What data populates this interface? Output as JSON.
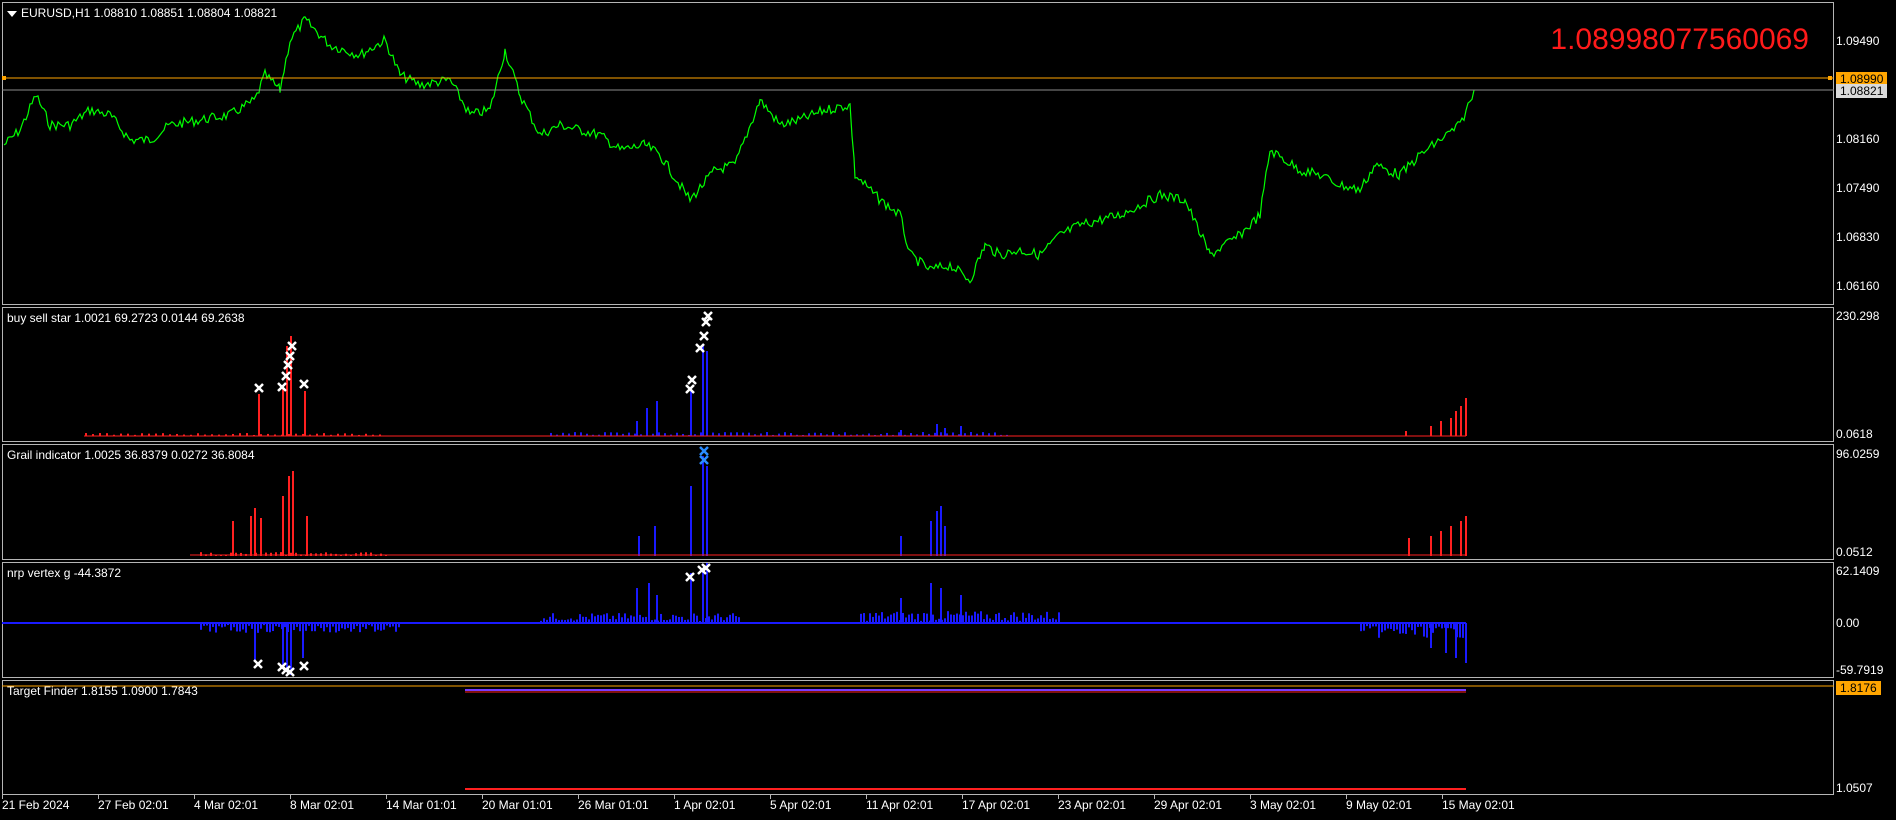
{
  "main": {
    "symbol_title": "EURUSD,H1  1.08810 1.08851 1.08804 1.08821",
    "big_price": "1.08998077560069",
    "price_axis": [
      "1.09490",
      "1.08160",
      "1.07490",
      "1.06830",
      "1.06160"
    ],
    "price_tag_orange": "1.08990",
    "price_tag_gray": "1.08821",
    "colors": {
      "price_line": "#00ff00",
      "hline": "#ffa500",
      "big_price": "#ff1a1a"
    }
  },
  "panes": [
    {
      "label": "buy sell star 1.0021 69.2723 0.0144 69.2638",
      "axis_top": "230.298",
      "axis_bottom": "0.0618"
    },
    {
      "label": "Grail indicator 1.0025 36.8379 0.0272 36.8084",
      "axis_top": "96.0259",
      "axis_bottom": "0.0512"
    },
    {
      "label": "nrp vertex g -44.3872",
      "axis_top": "62.1409",
      "axis_mid": "0.00",
      "axis_bottom": "-59.7919"
    },
    {
      "label": "Target Finder 1.8155 1.0900 1.7843",
      "axis_tag": "1.8176",
      "axis_bottom": "1.0507"
    }
  ],
  "time_axis": [
    "21 Feb 2024",
    "27 Feb 02:01",
    "4 Mar 02:01",
    "8 Mar 02:01",
    "14 Mar 01:01",
    "20 Mar 01:01",
    "26 Mar 01:01",
    "1 Apr 02:01",
    "5 Apr 02:01",
    "11 Apr 02:01",
    "17 Apr 02:01",
    "23 Apr 02:01",
    "29 Apr 02:01",
    "3 May 02:01",
    "9 May 02:01",
    "15 May 02:01"
  ]
}
